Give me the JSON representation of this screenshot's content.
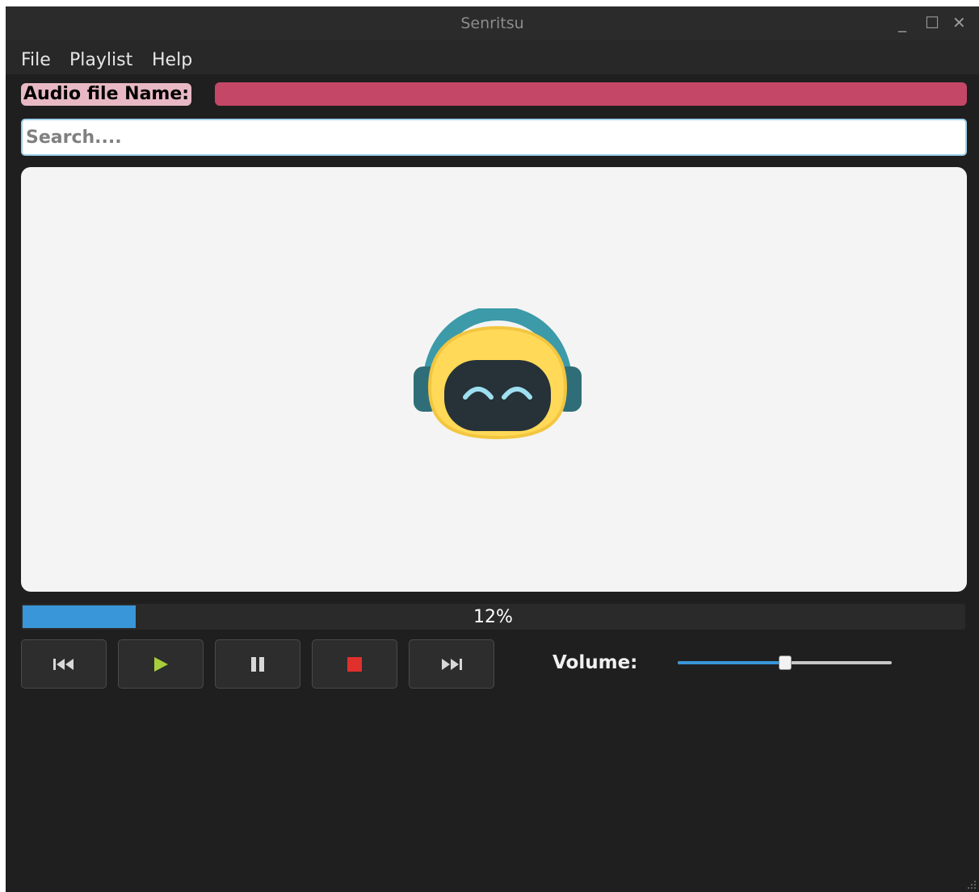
{
  "window": {
    "title": "Senritsu"
  },
  "window_controls": {
    "minimize": "_",
    "maximize": "☐",
    "close": "✕"
  },
  "menu": {
    "items": [
      {
        "label": "File"
      },
      {
        "label": "Playlist"
      },
      {
        "label": "Help"
      }
    ]
  },
  "file_info": {
    "label": "Audio file Name:",
    "value": ""
  },
  "search": {
    "placeholder": "Search....",
    "value": ""
  },
  "progress": {
    "value": 0.12,
    "text": "12%"
  },
  "controls": {
    "buttons": [
      {
        "icon": "skip-back-icon"
      },
      {
        "icon": "play-icon"
      },
      {
        "icon": "pause-icon"
      },
      {
        "icon": "stop-icon"
      },
      {
        "icon": "skip-forward-icon"
      }
    ]
  },
  "volume": {
    "label": "Volume:",
    "value": 0.5
  },
  "colors": {
    "accent_blue": "#3996d8",
    "file_value_bg": "#c44767",
    "file_label_bg": "#e8b9c4",
    "play_green": "#a8cf3b",
    "stop_red": "#e0302c"
  }
}
